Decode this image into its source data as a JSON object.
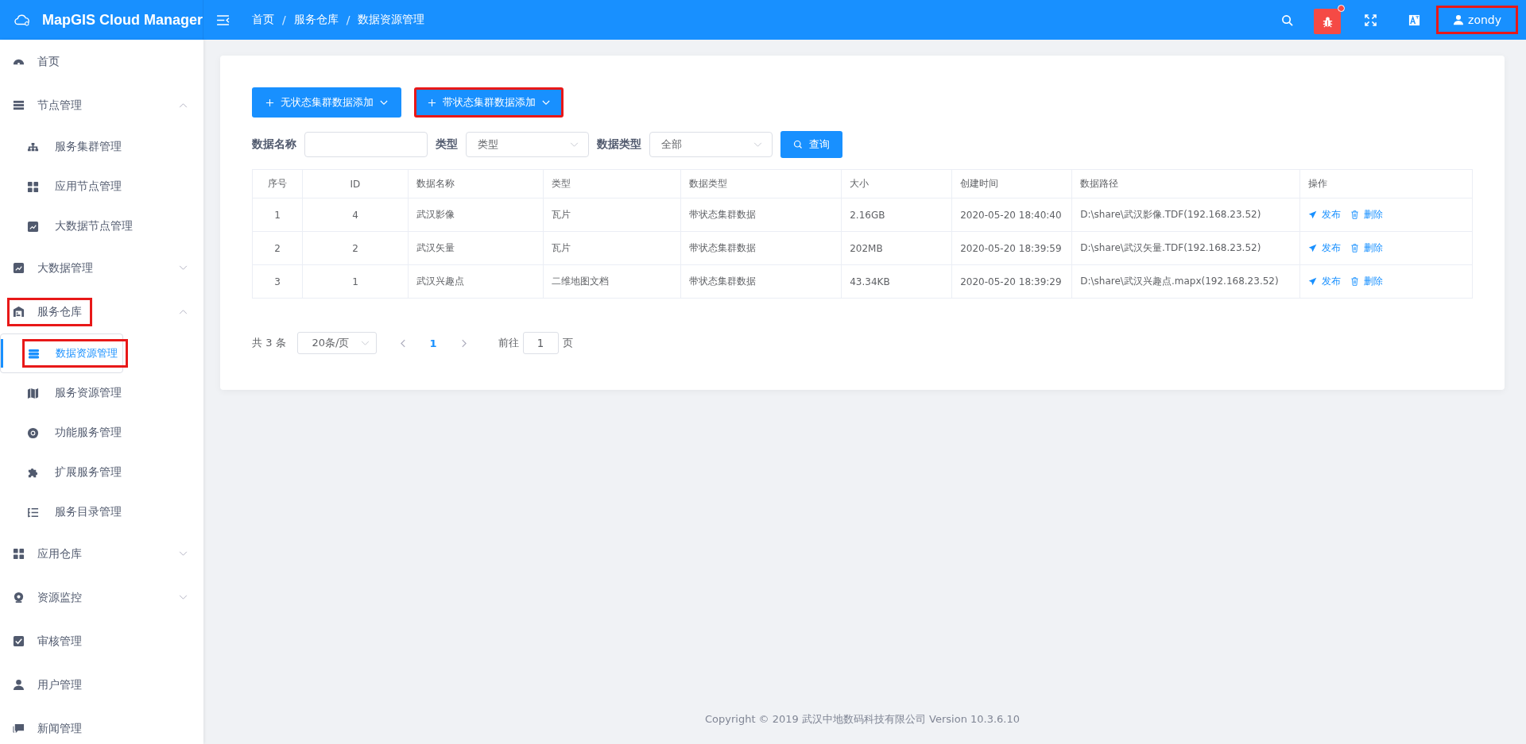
{
  "header": {
    "title": "MapGIS Cloud Manager",
    "breadcrumbs": [
      "首页",
      "服务仓库",
      "数据资源管理"
    ],
    "breadcrumb_separator": "/",
    "user": {
      "name": "zondy",
      "highlighted": true
    },
    "bug_badge": true
  },
  "sidebar": {
    "items": [
      {
        "label": "首页",
        "kind": "gauge",
        "selected": false,
        "highlighted": false
      },
      {
        "label": "节点管理",
        "kind": "server",
        "expanded": true,
        "selected": false,
        "highlighted": false,
        "children": [
          {
            "label": "服务集群管理",
            "kind": "sitemap",
            "selected": false,
            "highlighted": false
          },
          {
            "label": "应用节点管理",
            "kind": "grid",
            "selected": false,
            "highlighted": false
          },
          {
            "label": "大数据节点管理",
            "kind": "chart",
            "selected": false,
            "highlighted": false
          }
        ]
      },
      {
        "label": "大数据管理",
        "kind": "chart",
        "expanded": false,
        "selected": false,
        "highlighted": false
      },
      {
        "label": "服务仓库",
        "kind": "warehouse",
        "expanded": true,
        "selected": false,
        "highlighted": true,
        "children": [
          {
            "label": "数据资源管理",
            "kind": "database",
            "selected": true,
            "highlighted": true
          },
          {
            "label": "服务资源管理",
            "kind": "map",
            "selected": false,
            "highlighted": false
          },
          {
            "label": "功能服务管理",
            "kind": "aperture",
            "selected": false,
            "highlighted": false
          },
          {
            "label": "扩展服务管理",
            "kind": "puzzle",
            "selected": false,
            "highlighted": false
          },
          {
            "label": "服务目录管理",
            "kind": "list",
            "selected": false,
            "highlighted": false
          }
        ]
      },
      {
        "label": "应用仓库",
        "kind": "grid",
        "expanded": false,
        "selected": false,
        "highlighted": false
      },
      {
        "label": "资源监控",
        "kind": "webcam",
        "expanded": false,
        "selected": false,
        "highlighted": false
      },
      {
        "label": "审核管理",
        "kind": "check",
        "selected": false,
        "highlighted": false
      },
      {
        "label": "用户管理",
        "kind": "user",
        "selected": false,
        "highlighted": false
      },
      {
        "label": "新闻管理",
        "kind": "chat",
        "selected": false,
        "highlighted": false
      }
    ]
  },
  "toolbar": {
    "buttons": [
      {
        "label": "无状态集群数据添加",
        "highlighted": false
      },
      {
        "label": "带状态集群数据添加",
        "highlighted": true
      }
    ]
  },
  "filters": {
    "name_label": "数据名称",
    "type_label": "类型",
    "type_placeholder": "类型",
    "datatype_label": "数据类型",
    "datatype_value": "全部",
    "search_button": "查询"
  },
  "table": {
    "columns": [
      "序号",
      "ID",
      "数据名称",
      "类型",
      "数据类型",
      "大小",
      "创建时间",
      "数据路径",
      "操作"
    ],
    "rows": [
      {
        "cells": [
          "1",
          "4",
          "武汉影像",
          "瓦片",
          "带状态集群数据",
          "2.16GB",
          "2020-05-20 18:40:40",
          "D:\\share\\武汉影像.TDF(192.168.23.52)"
        ],
        "actions": [
          "发布",
          "删除"
        ]
      },
      {
        "cells": [
          "2",
          "2",
          "武汉矢量",
          "瓦片",
          "带状态集群数据",
          "202MB",
          "2020-05-20 18:39:59",
          "D:\\share\\武汉矢量.TDF(192.168.23.52)"
        ],
        "actions": [
          "发布",
          "删除"
        ]
      },
      {
        "cells": [
          "3",
          "1",
          "武汉兴趣点",
          "二维地图文档",
          "带状态集群数据",
          "43.34KB",
          "2020-05-20 18:39:29",
          "D:\\share\\武汉兴趣点.mapx(192.168.23.52)"
        ],
        "actions": [
          "发布",
          "删除"
        ]
      }
    ]
  },
  "pagination": {
    "total": "共 3 条",
    "page_size": "20条/页",
    "pages": [
      {
        "label": "1",
        "selected": true
      }
    ],
    "goto_label": "前往",
    "goto_value": "1",
    "page_suffix": "页"
  },
  "footer": "Copyright © 2019 武汉中地数码科技有限公司 Version 10.3.6.10"
}
